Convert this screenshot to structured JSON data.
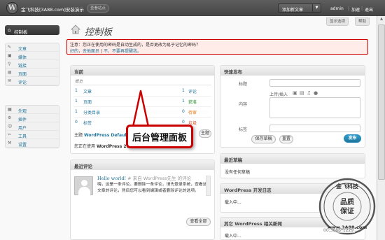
{
  "topbar": {
    "site_name": "金飞科技[3A88.com]安装演示",
    "visit_site": "查看站点",
    "new_post": "添加新文章",
    "user": "admin",
    "sep": "|",
    "help": "加速",
    "logout": "退出"
  },
  "screen_options": {
    "options": "显示选项",
    "help": "帮助"
  },
  "sidebar": {
    "dashboard": "控制板",
    "group1": [
      {
        "icon": "pin-icon",
        "glyph": "✎",
        "label": "文章"
      },
      {
        "icon": "media-icon",
        "glyph": "▣",
        "label": "媒体"
      },
      {
        "icon": "links-icon",
        "glyph": "⚲",
        "label": "链接"
      },
      {
        "icon": "pages-icon",
        "glyph": "▤",
        "label": "页面"
      },
      {
        "icon": "comments-icon",
        "glyph": "✉",
        "label": "评论"
      }
    ],
    "group2": [
      {
        "icon": "appearance-icon",
        "glyph": "▦",
        "label": "外观"
      },
      {
        "icon": "plugins-icon",
        "glyph": "⚙",
        "label": "插件"
      },
      {
        "icon": "users-icon",
        "glyph": "☺",
        "label": "用户"
      },
      {
        "icon": "tools-icon",
        "glyph": "✂",
        "label": "工具"
      },
      {
        "icon": "settings-icon",
        "glyph": "⚒",
        "label": "设置"
      }
    ]
  },
  "page": {
    "title": "控制板"
  },
  "notice": {
    "text": "注意：您正在使用的密码是自动生成的，是否更改为易于记忆的密码？",
    "link_yes": "好的，去他面员",
    "sep": "|",
    "link_no": "不，不要再提醒我。"
  },
  "right_now": {
    "title": "当前",
    "content_label": "概览",
    "rows": [
      {
        "num": "1",
        "label": "文章",
        "num2": "1",
        "label2": "评论",
        "color2": "#21759b"
      },
      {
        "num": "1",
        "label": "页面",
        "num2": "1",
        "label2": "获准",
        "color2": "#298f2b"
      },
      {
        "num": "1",
        "label": "分类目录",
        "num2": "0",
        "label2": "待审",
        "color2": "#e66f00"
      },
      {
        "num": "0",
        "label": "标签",
        "num2": "0",
        "label2": "垃圾",
        "color2": "#d54e21"
      }
    ],
    "theme_prefix": "主题",
    "theme_name": "WordPress Default",
    "version_prefix": "您正在使用",
    "version_name": "WordPress 2.8",
    "change_theme": "主题"
  },
  "recent_comments": {
    "title": "最近评论",
    "post": "Hello world!",
    "meta": "# 来自 WordPress先生 的评论",
    "body": "嗨，这是一条评论。要删除一条评论，请先登录系统，查看这篇文章的评论，然后您可以看到编辑或者删除评论的选项。",
    "view_all": "查看全部"
  },
  "quick_press": {
    "title": "快速发布",
    "label_title": "标题",
    "upload_label": "上传/插入",
    "label_content": "内容",
    "label_tags": "标签",
    "save_draft": "保存草稿",
    "reset": "重置",
    "publish": "发布"
  },
  "recent_drafts": {
    "title": "最近草稿",
    "text": "没有任何草稿"
  },
  "dev_news": {
    "title": "WordPress 开发日志",
    "text": "载入中..."
  },
  "other_news": {
    "title": "其它 WordPress 相关新闻",
    "text": "载入中..."
  },
  "callout": {
    "text": "后台管理面板"
  },
  "stamp": {
    "text": "金飞科技 品质保证 www.3A88.com"
  },
  "watermark": "00:3086*1229"
}
